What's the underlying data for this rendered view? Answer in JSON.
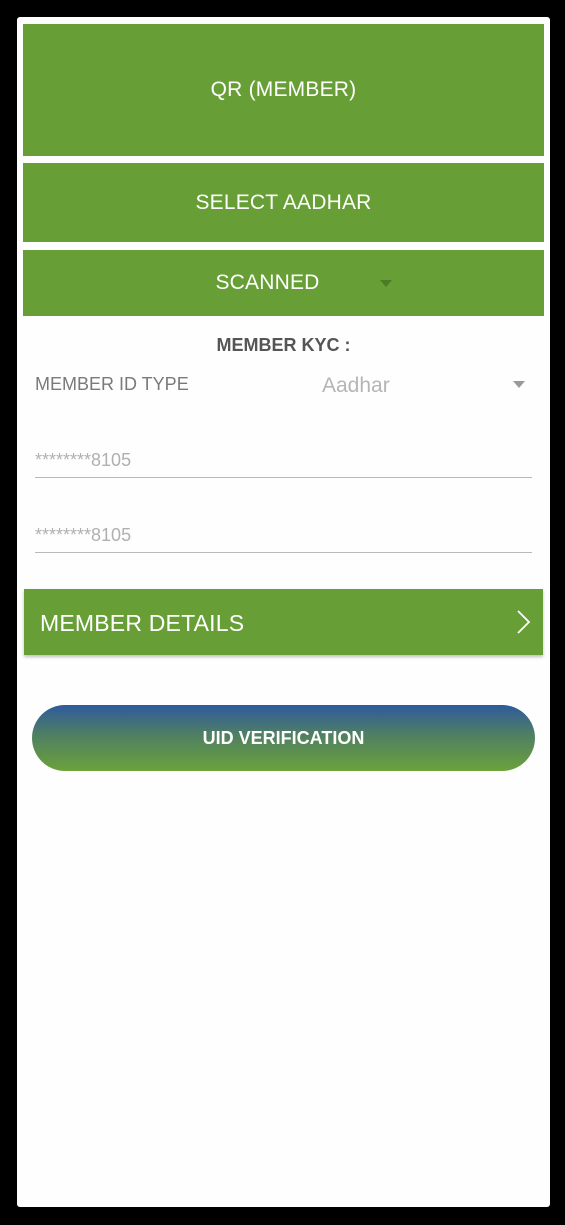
{
  "header": {
    "qr_member_label": "QR (MEMBER)",
    "select_aadhar_label": "SELECT AADHAR",
    "scanned_select_value": "SCANNED"
  },
  "kyc": {
    "heading": "MEMBER KYC :",
    "id_type_label": "MEMBER ID TYPE",
    "id_type_value": "Aadhar",
    "id_number_value": "********8105",
    "id_number_confirm_value": "********8105"
  },
  "member_details": {
    "label": "MEMBER DETAILS",
    "icon": "chevron-right-icon"
  },
  "uid_verification": {
    "label": "UID VERIFICATION"
  },
  "colors": {
    "brand_green": "#679f36",
    "gradient_blue": "#2f5a9c",
    "background": "#fdfefd",
    "frame": "#000000"
  }
}
